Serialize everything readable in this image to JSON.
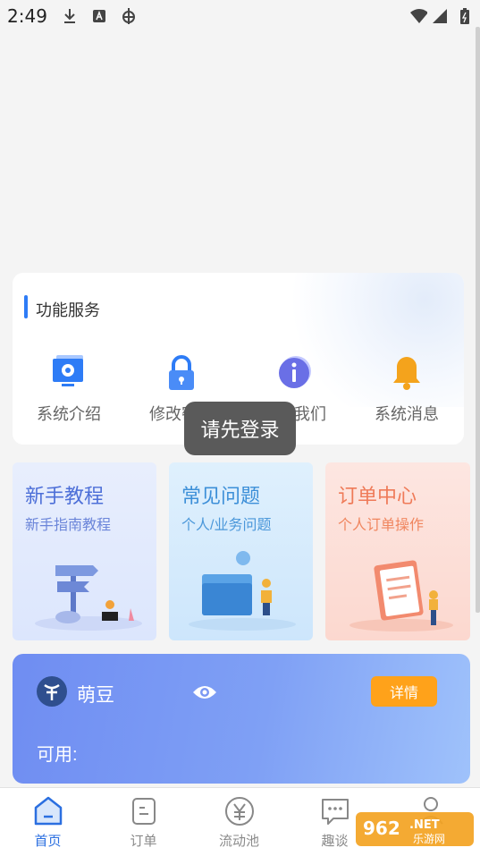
{
  "status_bar": {
    "time": "2:49"
  },
  "services": {
    "title": "功能服务",
    "items": [
      {
        "label": "系统介绍",
        "icon": "gear-monitor-icon"
      },
      {
        "label": "修改密码",
        "icon": "lock-icon"
      },
      {
        "label": "关于我们",
        "icon": "info-icon"
      },
      {
        "label": "系统消息",
        "icon": "bell-icon"
      }
    ]
  },
  "toast": {
    "text": "请先登录"
  },
  "features": [
    {
      "title": "新手教程",
      "subtitle": "新手指南教程"
    },
    {
      "title": "常见问题",
      "subtitle": "个人/业务问题"
    },
    {
      "title": "订单中心",
      "subtitle": "个人订单操作"
    }
  ],
  "points": {
    "name": "萌豆",
    "detail_button": "详情",
    "available_label": "可用:"
  },
  "nav": {
    "items": [
      {
        "label": "首页",
        "icon": "home-icon",
        "active": true
      },
      {
        "label": "订单",
        "icon": "order-icon",
        "active": false
      },
      {
        "label": "流动池",
        "icon": "yuan-coin-icon",
        "active": false
      },
      {
        "label": "趣谈",
        "icon": "chat-icon",
        "active": false
      },
      {
        "label": "",
        "icon": "profile-icon",
        "active": false
      }
    ]
  },
  "watermark": {
    "text": "962.NET",
    "subtext": "乐游网"
  },
  "colors": {
    "accent": "#2e7cf6",
    "button": "#ffa21a",
    "nav_active": "#2b6fe0"
  }
}
